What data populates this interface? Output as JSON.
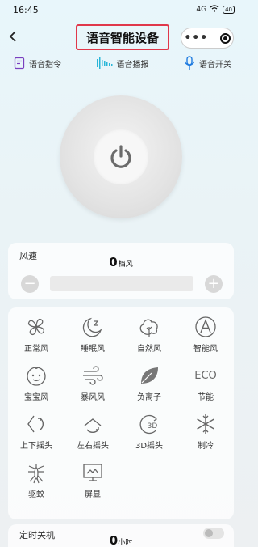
{
  "status_bar": {
    "time": "16:45",
    "network": "4G",
    "battery": "40"
  },
  "header": {
    "title": "语音智能设备",
    "more_icon": "ellipsis-icon",
    "close_icon": "target-icon"
  },
  "quick_bar": [
    {
      "label": "语音指令",
      "icon": "command-doc-icon",
      "color": "#7a3fbf"
    },
    {
      "label": "语音播报",
      "icon": "soundwave-icon",
      "color": "#29b6d8"
    },
    {
      "label": "语音开关",
      "icon": "microphone-icon",
      "color": "#1f7be0"
    }
  ],
  "power": {
    "icon": "power-icon"
  },
  "wind": {
    "label": "风速",
    "value": "0",
    "unit": "档风",
    "minus": "−",
    "plus": "+"
  },
  "modes": [
    {
      "label": "正常风",
      "icon": "fan-icon"
    },
    {
      "label": "睡眠风",
      "icon": "moon-icon"
    },
    {
      "label": "自然风",
      "icon": "leaf-tree-icon"
    },
    {
      "label": "智能风",
      "icon": "auto-a-icon"
    },
    {
      "label": "宝宝风",
      "icon": "baby-icon"
    },
    {
      "label": "暴风风",
      "icon": "storm-wind-icon"
    },
    {
      "label": "负离子",
      "icon": "leaf-icon"
    },
    {
      "label": "节能",
      "icon": "eco-icon",
      "text": "ECO"
    },
    {
      "label": "上下摇头",
      "icon": "vertical-swing-icon"
    },
    {
      "label": "左右摇头",
      "icon": "horizontal-swing-icon"
    },
    {
      "label": "3D摇头",
      "icon": "swing-3d-icon",
      "text": "3D"
    },
    {
      "label": "制冷",
      "icon": "snowflake-icon"
    },
    {
      "label": "驱蚊",
      "icon": "mosquito-icon"
    },
    {
      "label": "屏显",
      "icon": "screen-icon"
    }
  ],
  "timer": {
    "label": "定时关机",
    "value": "0",
    "unit": "小时"
  },
  "colors": {
    "title_border": "#e0384a",
    "icon_gray": "#666666"
  }
}
